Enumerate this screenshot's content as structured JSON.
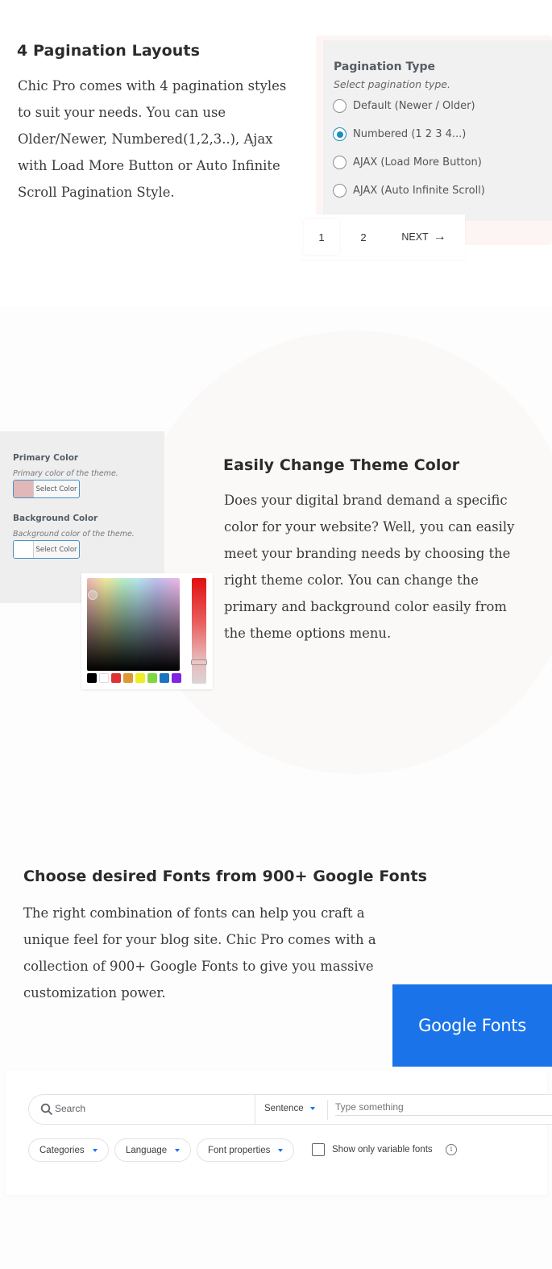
{
  "pagination_section": {
    "heading": "4 Pagination Layouts",
    "description": "Chic Pro comes with 4 pagination styles to suit your needs. You can use Older/Newer, Numbered(1,2,3..), Ajax with Load More Button or Auto Infinite Scroll Pagination Style.",
    "settings_panel": {
      "title": "Pagination Type",
      "subtitle": "Select pagination type.",
      "options": [
        {
          "label": "Default (Newer / Older)",
          "checked": false
        },
        {
          "label": "Numbered (1 2 3 4...)",
          "checked": true
        },
        {
          "label": "AJAX (Load More Button)",
          "checked": false
        },
        {
          "label": "AJAX (Auto Infinite Scroll)",
          "checked": false
        }
      ]
    },
    "pagination_bar": {
      "page1": "1",
      "page2": "2",
      "next_label": "NEXT",
      "next_icon": "→"
    }
  },
  "color_section": {
    "heading": "Easily Change Theme Color",
    "description": "Does your digital brand demand a specific color for your website? Well, you can easily meet your branding needs by choosing the right theme color. You can change the primary and background color easily from the theme options menu.",
    "settings_panel": {
      "primary": {
        "label": "Primary Color",
        "description": "Primary color of the theme.",
        "button_label": "Select Color",
        "swatch_color": "#e0b8b8"
      },
      "background": {
        "label": "Background Color",
        "description": "Background color of the theme.",
        "button_label": "Select Color",
        "swatch_color": "#ffffff"
      }
    },
    "color_picker": {
      "palette": [
        "#000000",
        "#ffffff",
        "#dd3333",
        "#dd9933",
        "#eeee22",
        "#81d742",
        "#1e73be",
        "#8224e3"
      ],
      "hue_level": 0.8
    }
  },
  "fonts_section": {
    "heading": "Choose desired Fonts from 900+ Google Fonts",
    "description": "The right combination of fonts can help you craft a unique feel for your blog site. Chic Pro comes with a collection of 900+ Google Fonts to give you massive customization power.",
    "banner_text": "Google Fonts",
    "banner_color": "#1a73e8",
    "toolbar": {
      "search_placeholder": "Search",
      "preview_mode": "Sentence",
      "preview_placeholder": "Type something",
      "filters": [
        "Categories",
        "Language",
        "Font properties"
      ],
      "variable_fonts_label": "Show only variable fonts",
      "variable_fonts_checked": false,
      "info_icon": "i"
    }
  }
}
